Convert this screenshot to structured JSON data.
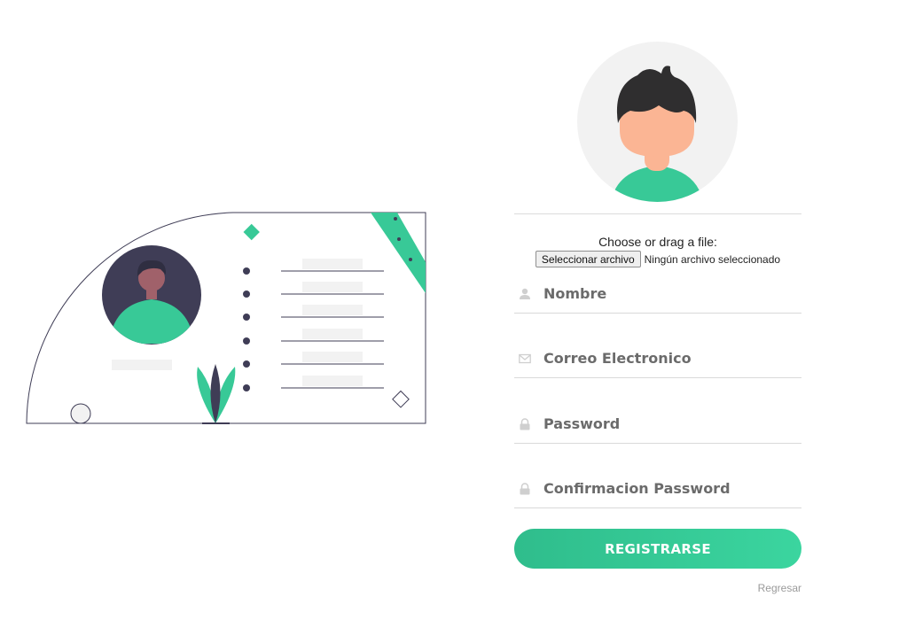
{
  "upload": {
    "prompt": "Choose or drag a file:",
    "button_label": "Seleccionar archivo",
    "status": "Ningún archivo seleccionado"
  },
  "form": {
    "name_placeholder": "Nombre",
    "email_placeholder": "Correo Electronico",
    "password_placeholder": "Password",
    "confirm_placeholder": "Confirmacion Password",
    "submit_label": "REGISTRARSE",
    "back_label": "Regresar"
  },
  "icons": [
    "user-icon",
    "envelope-icon",
    "lock-icon",
    "lock-icon"
  ],
  "colors": {
    "accent": "#38c997",
    "dark": "#3f3d56",
    "skin": "#fbb594",
    "hair": "#2f2e2f"
  }
}
